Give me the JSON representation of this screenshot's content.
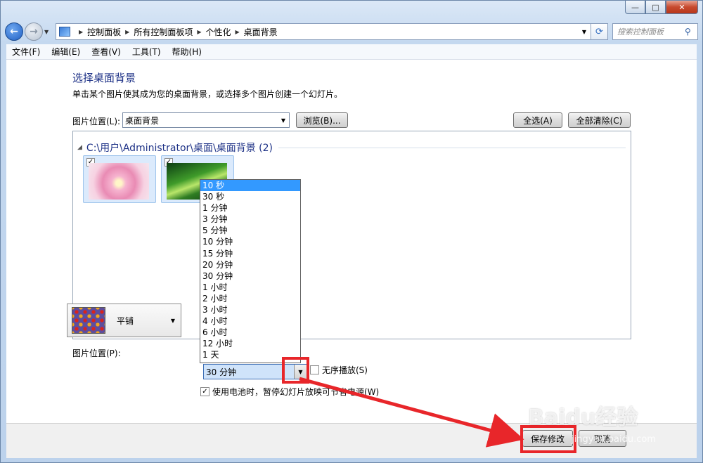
{
  "window": {
    "caption_buttons": {
      "minimize": "—",
      "maximize": "□",
      "close": "✕"
    }
  },
  "nav": {
    "breadcrumbs": [
      "控制面板",
      "所有控制面板项",
      "个性化",
      "桌面背景"
    ],
    "search_placeholder": "搜索控制面板"
  },
  "menubar": {
    "items": [
      "文件(F)",
      "编辑(E)",
      "查看(V)",
      "工具(T)",
      "帮助(H)"
    ]
  },
  "main": {
    "title": "选择桌面背景",
    "subtitle": "单击某个图片使其成为您的桌面背景，或选择多个图片创建一个幻灯片。",
    "location_label": "图片位置(L):",
    "location_value": "桌面背景",
    "browse_button": "浏览(B)...",
    "select_all_button": "全选(A)",
    "clear_all_button": "全部清除(C)",
    "group_header": "C:\\用户\\Administrator\\桌面\\桌面背景 (2)",
    "thumbnails": [
      {
        "checked": "✓",
        "image": "pink-flower"
      },
      {
        "checked": "✓",
        "image": "green-leaves"
      }
    ],
    "position_label": "图片位置(P):",
    "position_value": "平铺",
    "interval_value": "30 分钟",
    "shuffle_label": "无序播放(S)",
    "shuffle_checked": "",
    "battery_label": "使用电池时，暂停幻灯片放映可节省电源(W)",
    "battery_checked": "✓"
  },
  "dropdown": {
    "options": [
      "10 秒",
      "30 秒",
      "1 分钟",
      "3 分钟",
      "5 分钟",
      "10 分钟",
      "15 分钟",
      "20 分钟",
      "30 分钟",
      "1 小时",
      "2 小时",
      "3 小时",
      "4 小时",
      "6 小时",
      "12 小时",
      "1 天"
    ],
    "highlighted": "10 秒"
  },
  "footer": {
    "save_button": "保存修改",
    "cancel_button": "取消"
  },
  "watermark": {
    "text": "Baidu经验",
    "sub": "jingyan.baidu.com"
  },
  "colors": {
    "annotation_red": "#e8262a",
    "title_blue": "#1e3287",
    "selection_blue": "#3399ff"
  }
}
